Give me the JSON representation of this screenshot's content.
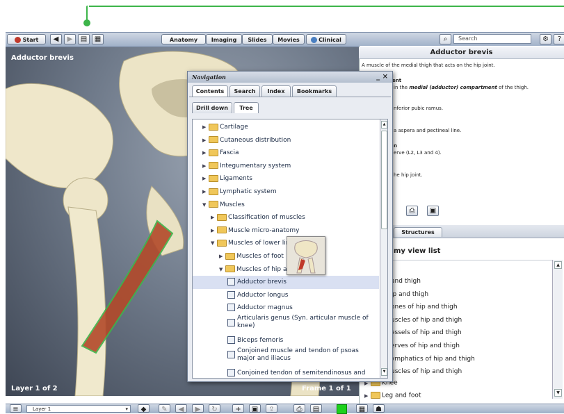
{
  "toolbar": {
    "start_label": "Start",
    "tabs": [
      "Anatomy",
      "Imaging",
      "Slides",
      "Movies",
      "Clinical"
    ],
    "search_placeholder": "Search"
  },
  "viewer": {
    "title": "Adductor brevis",
    "layer_text": "Layer 1 of 2",
    "frame_text": "Frame 1 of 1"
  },
  "info": {
    "title": "Adductor brevis",
    "lines": [
      "A muscle of the medial thigh that acts on the hip joint.",
      "ent",
      "in the",
      "medial (adductor) compartment",
      "of the thigh.",
      "nferior pubic ramus.",
      "a aspera and pectineal line.",
      "n",
      "erve (L2, L3 and 4).",
      "he hip joint."
    ]
  },
  "lower": {
    "tab_structures": "Structures",
    "heading": "my view list",
    "items": [
      "and thigh",
      "ip and thigh",
      "ones of hip and thigh",
      "uscles of hip and thigh",
      "essels of hip and thigh",
      "erves of hip and thigh",
      "ymphatics of hip and thigh",
      "uscles of hip and thigh"
    ],
    "tree_knee": "Knee",
    "tree_leg": "Leg and foot"
  },
  "nav": {
    "title": "Navigation",
    "close": "_ ×",
    "tabs": [
      "Contents",
      "Search",
      "Index",
      "Bookmarks"
    ],
    "subtabs": [
      "Drill down",
      "Tree"
    ],
    "tree": [
      {
        "label": "Cartilage",
        "kind": "folder",
        "open": false,
        "indent": 0
      },
      {
        "label": "Cutaneous distribution",
        "kind": "folder",
        "open": false,
        "indent": 0
      },
      {
        "label": "Fascia",
        "kind": "folder",
        "open": false,
        "indent": 0
      },
      {
        "label": "Integumentary system",
        "kind": "folder",
        "open": false,
        "indent": 0
      },
      {
        "label": "Ligaments",
        "kind": "folder",
        "open": false,
        "indent": 0
      },
      {
        "label": "Lymphatic system",
        "kind": "folder",
        "open": false,
        "indent": 0
      },
      {
        "label": "Muscles",
        "kind": "folder",
        "open": true,
        "indent": 0
      },
      {
        "label": "Classification of muscles",
        "kind": "folder",
        "open": false,
        "indent": 1
      },
      {
        "label": "Muscle micro-anatomy",
        "kind": "folder",
        "open": false,
        "indent": 1
      },
      {
        "label": "Muscles of lower lin",
        "kind": "folder",
        "open": true,
        "indent": 1
      },
      {
        "label": "Muscles of foot",
        "kind": "folder",
        "open": false,
        "indent": 2
      },
      {
        "label": "Muscles of hip ar",
        "kind": "folder",
        "open": true,
        "indent": 2
      },
      {
        "label": "Adductor brevis",
        "kind": "doc",
        "indent": 3,
        "selected": true
      },
      {
        "label": "Adductor longus",
        "kind": "doc",
        "indent": 3
      },
      {
        "label": "Adductor magnus",
        "kind": "doc",
        "indent": 3
      },
      {
        "label": "Articularis genus (Syn. articular muscle of knee)",
        "kind": "doc",
        "indent": 3,
        "double": true
      },
      {
        "label": "Biceps femoris",
        "kind": "doc",
        "indent": 3
      },
      {
        "label": "Conjoined muscle and tendon of psoas major and iliacus",
        "kind": "doc",
        "indent": 3,
        "double": true
      },
      {
        "label": "Conjoined tendon of semitendinosus and",
        "kind": "doc",
        "indent": 3
      }
    ]
  },
  "bottom": {
    "layer_select": "Layer 1"
  },
  "colors": {
    "accent_green": "#3db54a",
    "muscle_red": "#b24a2a"
  }
}
